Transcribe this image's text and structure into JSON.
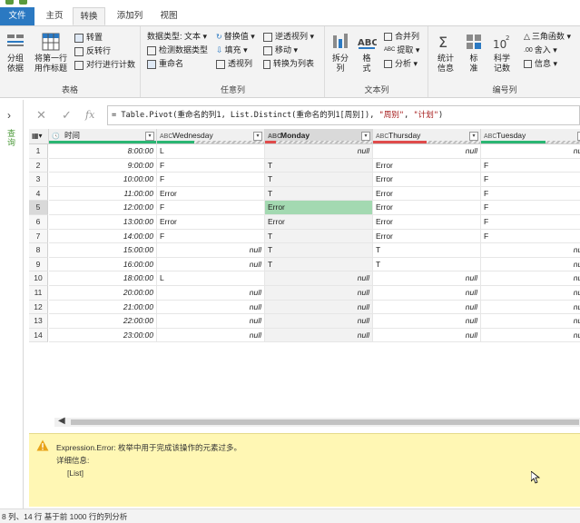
{
  "window": {
    "title": "Power Query 编辑器"
  },
  "tabs": [
    {
      "label": "文件"
    },
    {
      "label": "主页"
    },
    {
      "label": "转换"
    },
    {
      "label": "添加列"
    },
    {
      "label": "视图"
    }
  ],
  "ribbon": {
    "group_table": {
      "label": "表格",
      "group_by": "分组\n依据",
      "first_row": "将第一行\n用作标题",
      "transpose": "转置",
      "reverse_rows": "反转行",
      "count_rows": "对行进行计数"
    },
    "group_any": {
      "label": "任意列",
      "data_type": "数据类型: 文本",
      "detect_type": "检测数据类型",
      "rename": "重命名",
      "replace_values": "替换值",
      "fill": "填充",
      "pivot": "透视列",
      "unpivot": "逆透视列",
      "move": "移动",
      "to_list": "转换为列表"
    },
    "group_text": {
      "label": "文本列",
      "split": "拆分\n列",
      "format": "格\n式",
      "merge": "合并列",
      "extract": "提取",
      "parse": "分析"
    },
    "group_number": {
      "label": "编号列",
      "stats": "统计\n信息",
      "standard": "标\n准",
      "scientific": "科学\n记数",
      "trig": "三角函数",
      "rounding": "舍入",
      "info": "信息"
    }
  },
  "left_panel": {
    "label": "查询"
  },
  "formula": {
    "prefix": "= Table.Pivot(重命名的列1, List.Distinct(重命名的列1[周别]), ",
    "arg1": "\"周别\"",
    "sep": ", ",
    "arg2": "\"计划\"",
    "suffix": ")"
  },
  "table": {
    "columns": [
      {
        "name": "时间",
        "type_icon": "🕓"
      },
      {
        "name": "Wednesday",
        "type_icon": "ABC"
      },
      {
        "name": "Monday",
        "type_icon": "ABC"
      },
      {
        "name": "Thursday",
        "type_icon": "ABC"
      },
      {
        "name": "Tuesday",
        "type_icon": "ABC"
      }
    ],
    "rows": [
      [
        "1",
        "8:00:00",
        "L",
        "null",
        "null",
        "null"
      ],
      [
        "2",
        "9:00:00",
        "F",
        "T",
        "Error",
        "F"
      ],
      [
        "3",
        "10:00:00",
        "F",
        "T",
        "Error",
        "F"
      ],
      [
        "4",
        "11:00:00",
        "Error",
        "T",
        "Error",
        "F"
      ],
      [
        "5",
        "12:00:00",
        "F",
        "Error",
        "Error",
        "F"
      ],
      [
        "6",
        "13:00:00",
        "Error",
        "Error",
        "Error",
        "F"
      ],
      [
        "7",
        "14:00:00",
        "F",
        "T",
        "Error",
        "F"
      ],
      [
        "8",
        "15:00:00",
        "null",
        "T",
        "T",
        "null"
      ],
      [
        "9",
        "16:00:00",
        "null",
        "T",
        "T",
        "null"
      ],
      [
        "10",
        "18:00:00",
        "L",
        "null",
        "null",
        "null"
      ],
      [
        "11",
        "20:00:00",
        "null",
        "null",
        "null",
        "null"
      ],
      [
        "12",
        "21:00:00",
        "null",
        "null",
        "null",
        "null"
      ],
      [
        "13",
        "22:00:00",
        "null",
        "null",
        "null",
        "null"
      ],
      [
        "14",
        "23:00:00",
        "null",
        "null",
        "null",
        "null"
      ]
    ]
  },
  "error_panel": {
    "message": "Expression.Error: 枚举中用于完成该操作的元素过多。",
    "detail_label": "详细信息:",
    "detail_value": "[List]"
  },
  "status": {
    "text": "8 列、14 行    基于前 1000 行的列分析"
  },
  "colors": {
    "accent_blue": "#2b79c2",
    "quality_green": "#2bb673",
    "quality_red": "#e04b4b",
    "error_cell": "#a3d9b1",
    "error_panel": "#fff7b4"
  }
}
